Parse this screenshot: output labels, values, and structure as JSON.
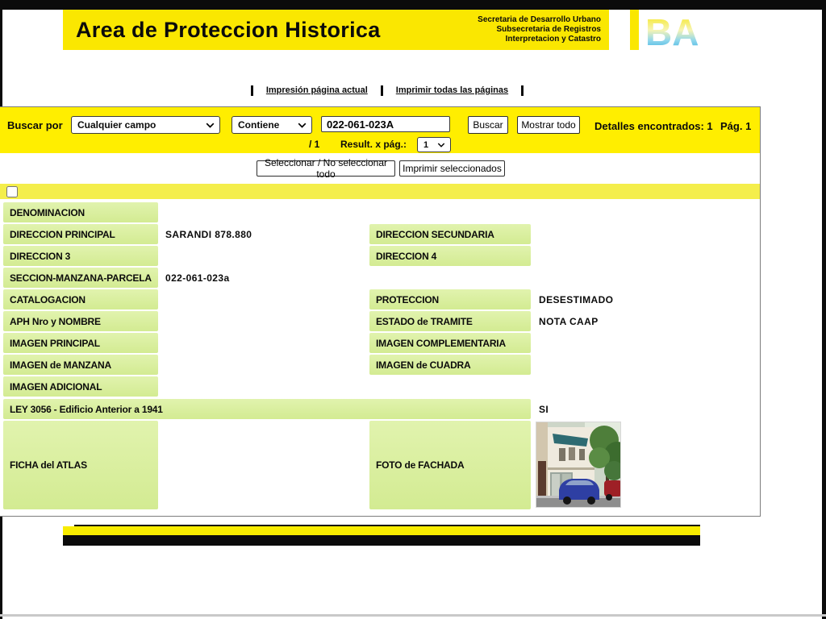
{
  "header": {
    "title": "Area de Proteccion Historica",
    "org_lines": [
      "Secretaria de Desarrollo Urbano",
      "Subsecretaria de Registros",
      "Interpretacion y Catastro"
    ],
    "logo_text": "BA"
  },
  "print_links": {
    "current_page": "Impresión página actual",
    "all_pages": "Imprimir todas las páginas"
  },
  "search": {
    "label": "Buscar por",
    "field_select": "Cualquier campo",
    "operator_select": "Contiene",
    "query_value": "022-061-023A",
    "buscar_button": "Buscar",
    "mostrar_todo_button": "Mostrar todo",
    "details_found": "Detalles encontrados: 1",
    "page_indicator": "Pág. 1",
    "page_fraction": "/ 1",
    "results_per_page_label": "Result. x pág.:",
    "results_per_page_value": "1"
  },
  "actions": {
    "select_all_button": "Seleccionar / No seleccionar todo",
    "print_selected_button": "Imprimir seleccionados"
  },
  "record": {
    "left_fields": [
      {
        "label": "DENOMINACION",
        "value": ""
      },
      {
        "label": "DIRECCION PRINCIPAL",
        "value": "SARANDI 878.880"
      },
      {
        "label": "DIRECCION 3",
        "value": ""
      },
      {
        "label": "SECCION-MANZANA-PARCELA",
        "value": "022-061-023a"
      },
      {
        "label": "CATALOGACION",
        "value": ""
      },
      {
        "label": "APH Nro y NOMBRE",
        "value": ""
      },
      {
        "label": "IMAGEN PRINCIPAL",
        "value": ""
      },
      {
        "label": "IMAGEN de MANZANA",
        "value": ""
      },
      {
        "label": "IMAGEN ADICIONAL",
        "value": ""
      }
    ],
    "right_fields": [
      {
        "label": "DIRECCION SECUNDARIA",
        "value": ""
      },
      {
        "label": "DIRECCION 4",
        "value": ""
      },
      {
        "label": "PROTECCION",
        "value": "DESESTIMADO"
      },
      {
        "label": "ESTADO de TRAMITE",
        "value": "NOTA CAAP"
      },
      {
        "label": "IMAGEN COMPLEMENTARIA",
        "value": ""
      },
      {
        "label": "IMAGEN de CUADRA",
        "value": ""
      }
    ],
    "ley_row": {
      "label": "LEY 3056 - Edificio Anterior a 1941",
      "value": "SI"
    },
    "ficha_label": "FICHA del ATLAS",
    "foto_label": "FOTO de FACHADA"
  },
  "colors": {
    "header_yellow": "#fae701",
    "search_band_yellow": "#ffee00",
    "row_band_yellow": "#f4ee4b",
    "cell_green": "#d8efa0",
    "logo_cyan": "#2aa9dc",
    "bar_black": "#0b0b0b"
  }
}
